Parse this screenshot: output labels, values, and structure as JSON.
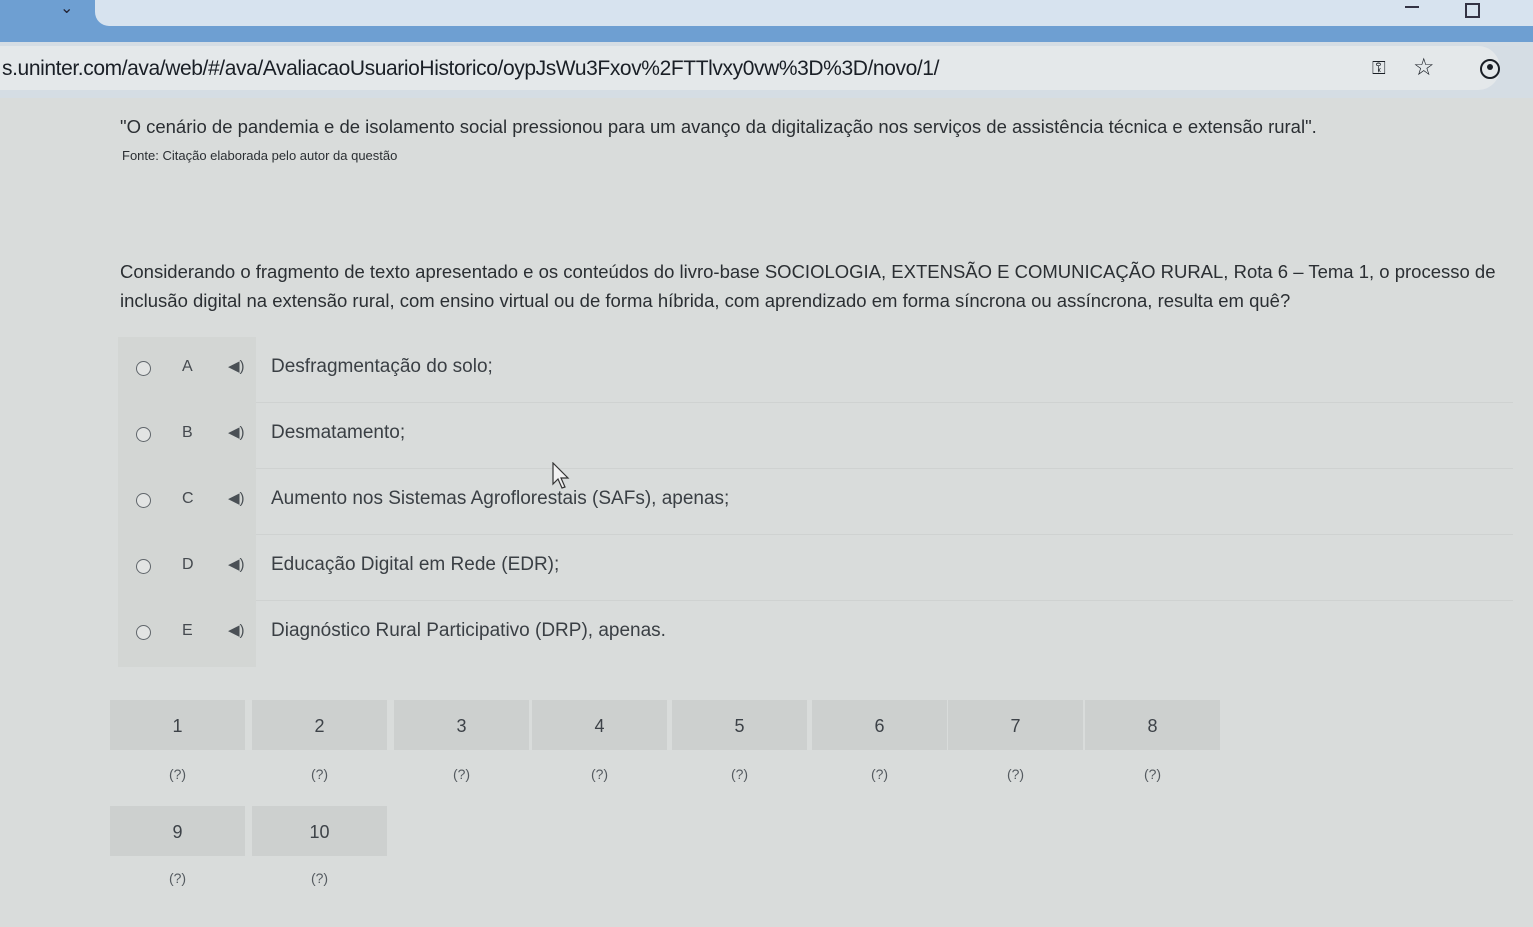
{
  "browser": {
    "url": "s.uninter.com/ava/web/#/ava/AvaliacaoUsuarioHistorico/oypJsWu3Fxov%2FTTlvxy0vw%3D%3D/novo/1/"
  },
  "question": {
    "quote": "\"O cenário de pandemia e de isolamento social pressionou para um avanço da digitalização nos serviços de assistência técnica e extensão rural\".",
    "source": "Fonte: Citação elaborada pelo autor da questão",
    "prompt": "Considerando o fragmento de texto apresentado e os conteúdos do livro-base SOCIOLOGIA, EXTENSÃO E COMUNICAÇÃO RURAL, Rota 6 – Tema 1, o processo de inclusão digital na extensão rural, com ensino virtual ou de forma híbrida, com aprendizado em forma síncrona ou assíncrona, resulta em quê?"
  },
  "options": [
    {
      "letter": "A",
      "text": "Desfragmentação do solo;"
    },
    {
      "letter": "B",
      "text": "Desmatamento;"
    },
    {
      "letter": "C",
      "text": "Aumento nos Sistemas Agroflorestais (SAFs), apenas;"
    },
    {
      "letter": "D",
      "text": "Educação Digital em Rede (EDR);"
    },
    {
      "letter": "E",
      "text": "Diagnóstico Rural Participativo (DRP), apenas."
    }
  ],
  "navigator": [
    {
      "num": "1",
      "status": "(?)"
    },
    {
      "num": "2",
      "status": "(?)"
    },
    {
      "num": "3",
      "status": "(?)"
    },
    {
      "num": "4",
      "status": "(?)"
    },
    {
      "num": "5",
      "status": "(?)"
    },
    {
      "num": "6",
      "status": "(?)"
    },
    {
      "num": "7",
      "status": "(?)"
    },
    {
      "num": "8",
      "status": "(?)"
    },
    {
      "num": "9",
      "status": "(?)"
    },
    {
      "num": "10",
      "status": "(?)"
    }
  ],
  "icons": {
    "speaker": "speaker-icon",
    "key": "key-icon",
    "star": "bookmark-star-icon",
    "profile": "profile-icon"
  }
}
